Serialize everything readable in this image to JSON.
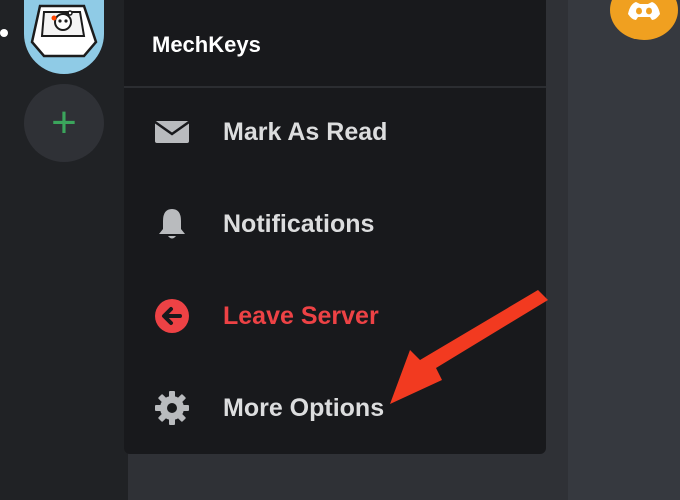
{
  "server": {
    "name": "MechKeys"
  },
  "menu": {
    "items": [
      {
        "label": "Mark As Read",
        "icon": "envelope-icon"
      },
      {
        "label": "Notifications",
        "icon": "bell-icon"
      },
      {
        "label": "Leave Server",
        "icon": "leave-arrow-icon",
        "danger": true
      },
      {
        "label": "More Options",
        "icon": "gear-icon"
      }
    ]
  },
  "sidebar": {
    "add_server_symbol": "+"
  },
  "colors": {
    "menu_bg": "#18191c",
    "text": "#dcddde",
    "danger": "#ed4245",
    "add_green": "#3ba55c",
    "annotation_arrow": "#f23a20"
  }
}
